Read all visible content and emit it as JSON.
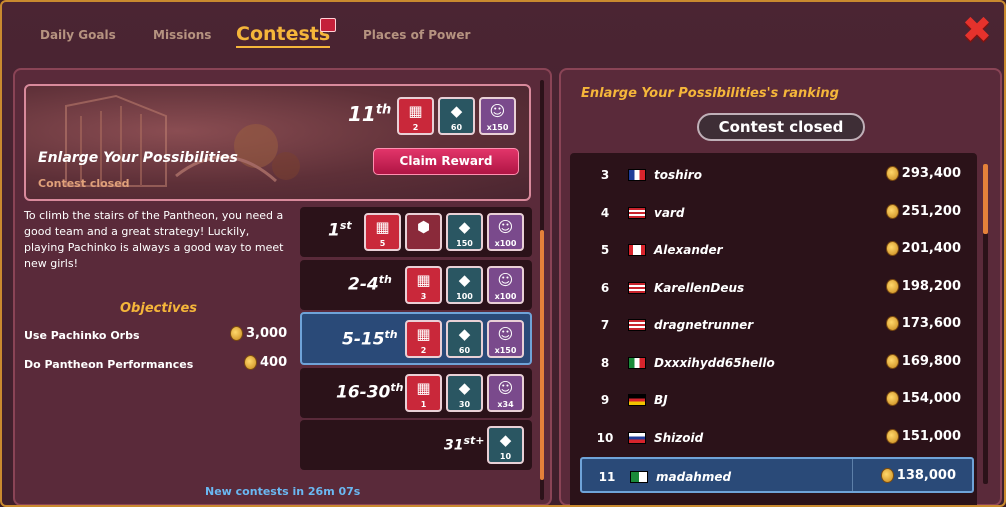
{
  "tabs": [
    {
      "label": "Daily Goals"
    },
    {
      "label": "Missions"
    },
    {
      "label": "Contests"
    },
    {
      "label": "Places of Power"
    }
  ],
  "close_icon": "close-x-icon",
  "contest": {
    "title": "Enlarge Your Possibilities",
    "status": "Contest closed",
    "rank_num": "11",
    "rank_suffix": "th",
    "claim_label": "Claim Reward",
    "banner_rewards": [
      "2",
      "60",
      "x150"
    ],
    "description": "To climb the stairs of the Pantheon, you need a good team and a great strategy! Luckily, playing Pachinko is always a good way to meet new girls!",
    "objectives_title": "Objectives",
    "objectives": [
      {
        "label": "Use Pachinko Orbs",
        "value": "3,000"
      },
      {
        "label": "Do Pantheon Performances",
        "value": "400"
      }
    ],
    "tiers": [
      {
        "num": "1",
        "sfx": "st",
        "rewards": [
          "5",
          "",
          "150",
          "x100"
        ]
      },
      {
        "num": "2-4",
        "sfx": "th",
        "rewards": [
          "3",
          "100",
          "x100"
        ]
      },
      {
        "num": "5-15",
        "sfx": "th",
        "rewards": [
          "2",
          "60",
          "x150"
        ]
      },
      {
        "num": "16-30",
        "sfx": "th",
        "rewards": [
          "1",
          "30",
          "x34"
        ]
      },
      {
        "num": "31",
        "sfx": "st+",
        "rewards": [
          "10"
        ]
      }
    ],
    "new_contests": "New contests in 26m 07s"
  },
  "ranking": {
    "title": "Enlarge Your Possibilities's ranking",
    "closed_label": "Contest closed",
    "rows": [
      {
        "pos": "3",
        "flag": "fr",
        "name": "toshiro",
        "score": "293,400"
      },
      {
        "pos": "4",
        "flag": "us",
        "name": "vard",
        "score": "251,200"
      },
      {
        "pos": "5",
        "flag": "ca",
        "name": "Alexander",
        "score": "201,400"
      },
      {
        "pos": "6",
        "flag": "us",
        "name": "KarellenDeus",
        "score": "198,200"
      },
      {
        "pos": "7",
        "flag": "us",
        "name": "dragnetrunner",
        "score": "173,600"
      },
      {
        "pos": "8",
        "flag": "it",
        "name": "Dxxxihydd65hello",
        "score": "169,800"
      },
      {
        "pos": "9",
        "flag": "de",
        "name": "BJ",
        "score": "154,000"
      },
      {
        "pos": "10",
        "flag": "ru",
        "name": "Shizoid",
        "score": "151,000"
      },
      {
        "pos": "11",
        "flag": "dz",
        "name": "madahmed",
        "score": "138,000"
      }
    ]
  },
  "colors": {
    "accent": "#f5b63a",
    "highlight": "#2a4a78",
    "claim": "#d42a5c"
  }
}
